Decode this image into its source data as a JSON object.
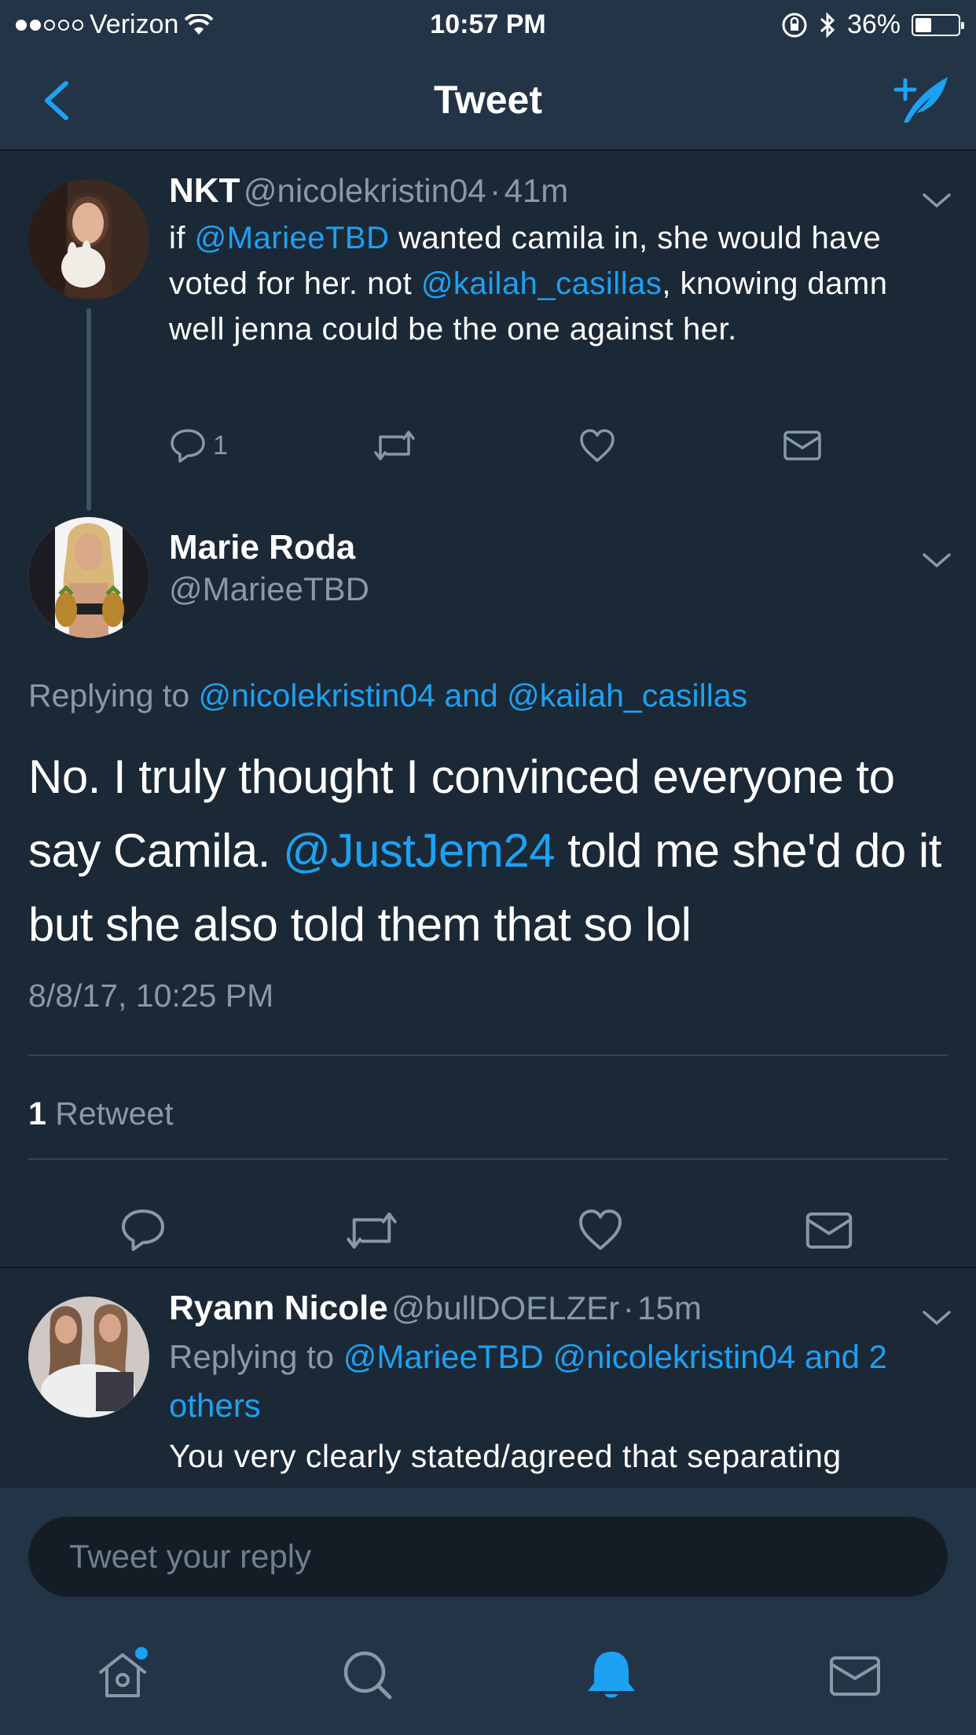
{
  "status_bar": {
    "carrier": "Verizon",
    "time": "10:57 PM",
    "battery": "36%"
  },
  "nav": {
    "title": "Tweet"
  },
  "parent_tweet": {
    "name": "NKT",
    "handle": "@nicolekristin04",
    "separator": "·",
    "time": "41m",
    "text_parts": [
      "if ",
      "@MarieeTBD",
      " wanted camila in, she would have voted for her. not ",
      "@kailah_casillas",
      ", knowing damn well jenna could be the one against her."
    ],
    "reply_count": "1"
  },
  "main_tweet": {
    "name": "Marie Roda",
    "handle": "@MarieeTBD",
    "replying_prefix": "Replying to ",
    "replying_user1": "@nicolekristin04",
    "replying_and": " and ",
    "replying_user2": "@kailah_casillas",
    "text_before": "No. I truly thought I convinced everyone to say Camila. ",
    "text_mention": "@JustJem24",
    "text_after": " told me she'd do it but she also told them that so lol",
    "timestamp": "8/8/17, 10:25 PM",
    "retweet_count": "1",
    "retweet_label": " Retweet"
  },
  "reply_tweet": {
    "name": "Ryann Nicole",
    "handle": "@bullDOELZEr",
    "separator": "·",
    "time": "15m",
    "replying_prefix": "Replying to ",
    "replying_users": "@MarieeTBD @nicolekristin04 and 2 others",
    "text": "You very clearly stated/agreed that separating"
  },
  "reply_box": {
    "placeholder": "Tweet your reply"
  },
  "colors": {
    "background": "#1b2836",
    "bar": "#243447",
    "accent": "#1da1f2",
    "muted": "#8899a6"
  },
  "icons": {
    "tabs": [
      "home-icon",
      "search-icon",
      "notifications-icon",
      "messages-icon"
    ],
    "active_tab": "notifications-icon"
  }
}
